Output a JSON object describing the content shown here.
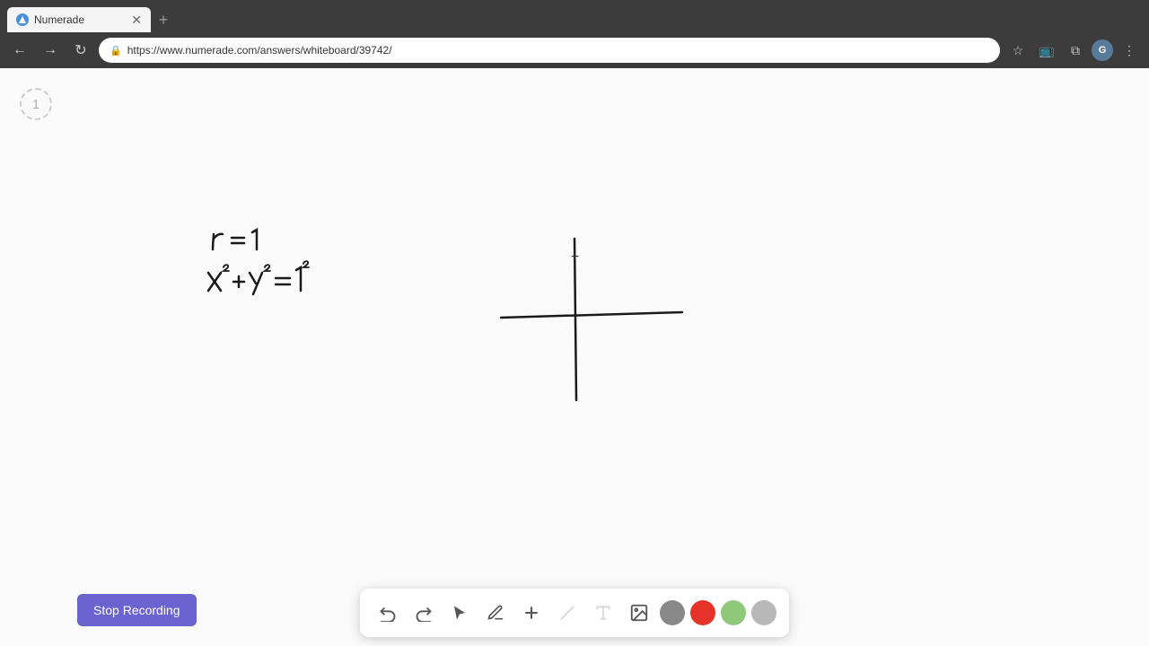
{
  "browser": {
    "tab_title": "Numerade",
    "tab_favicon": "N",
    "url": "https://www.numerade.com/answers/whiteboard/39742/",
    "profile_letter": "G",
    "new_tab_label": "+"
  },
  "page_indicator": {
    "value": "1"
  },
  "toolbar": {
    "undo_label": "↺",
    "redo_label": "↻",
    "select_label": "▶",
    "pen_label": "✏",
    "add_label": "+",
    "line_label": "/",
    "text_label": "T",
    "image_label": "🖼",
    "colors": {
      "gray": "#888888",
      "red": "#e63329",
      "light_green": "#8ec97a",
      "light_gray": "#b0b0b0"
    }
  },
  "stop_recording_button": {
    "label": "Stop Recording"
  },
  "drawings": {
    "equation1": "r = 1",
    "equation2": "x² + y² = 1²"
  }
}
